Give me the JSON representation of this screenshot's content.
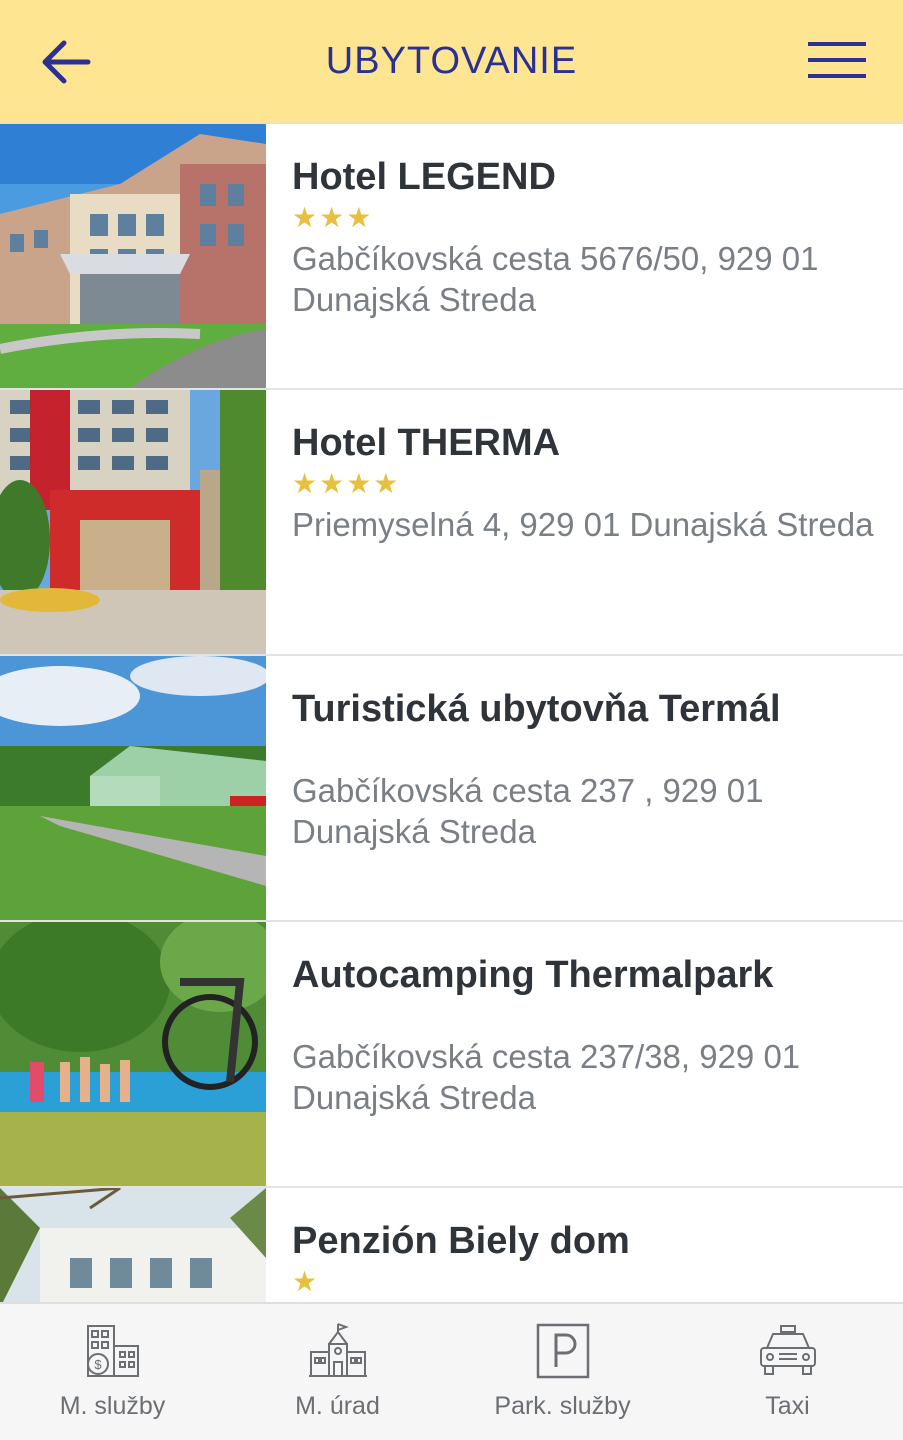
{
  "header": {
    "title": "UBYTOVANIE",
    "back_icon": "arrow-left-icon",
    "menu_icon": "hamburger-menu-icon",
    "color_background": "#fde591",
    "color_accent": "#2b3190"
  },
  "accommodations": [
    {
      "name": "Hotel LEGEND",
      "stars": "★★★",
      "star_count": 3,
      "address": "Gabčíkovská cesta 5676/50, 929 01 Dunajská Streda"
    },
    {
      "name": "Hotel THERMA",
      "stars": "★★★★",
      "star_count": 4,
      "address": "Priemyselná 4, 929 01 Dunajská Streda"
    },
    {
      "name": "Turistická ubytovňa Termál",
      "stars": "",
      "star_count": 0,
      "address": "Gabčíkovská cesta 237 , 929 01 Dunajská Streda"
    },
    {
      "name": "Autocamping Thermalpark",
      "stars": "",
      "star_count": 0,
      "address": "Gabčíkovská cesta 237/38, 929 01 Dunajská Streda"
    },
    {
      "name": "Penzión Biely dom",
      "stars": "★",
      "star_count": 1,
      "address": ""
    }
  ],
  "tabbar": {
    "tabs": [
      {
        "label": "M. služby",
        "icon": "city-services-icon"
      },
      {
        "label": "M. úrad",
        "icon": "town-hall-icon"
      },
      {
        "label": "Park. služby",
        "icon": "parking-icon"
      },
      {
        "label": "Taxi",
        "icon": "taxi-icon"
      }
    ]
  },
  "colors": {
    "star": "#e7c03f",
    "name_text": "#2f343b",
    "address_text": "#7a7f85"
  }
}
